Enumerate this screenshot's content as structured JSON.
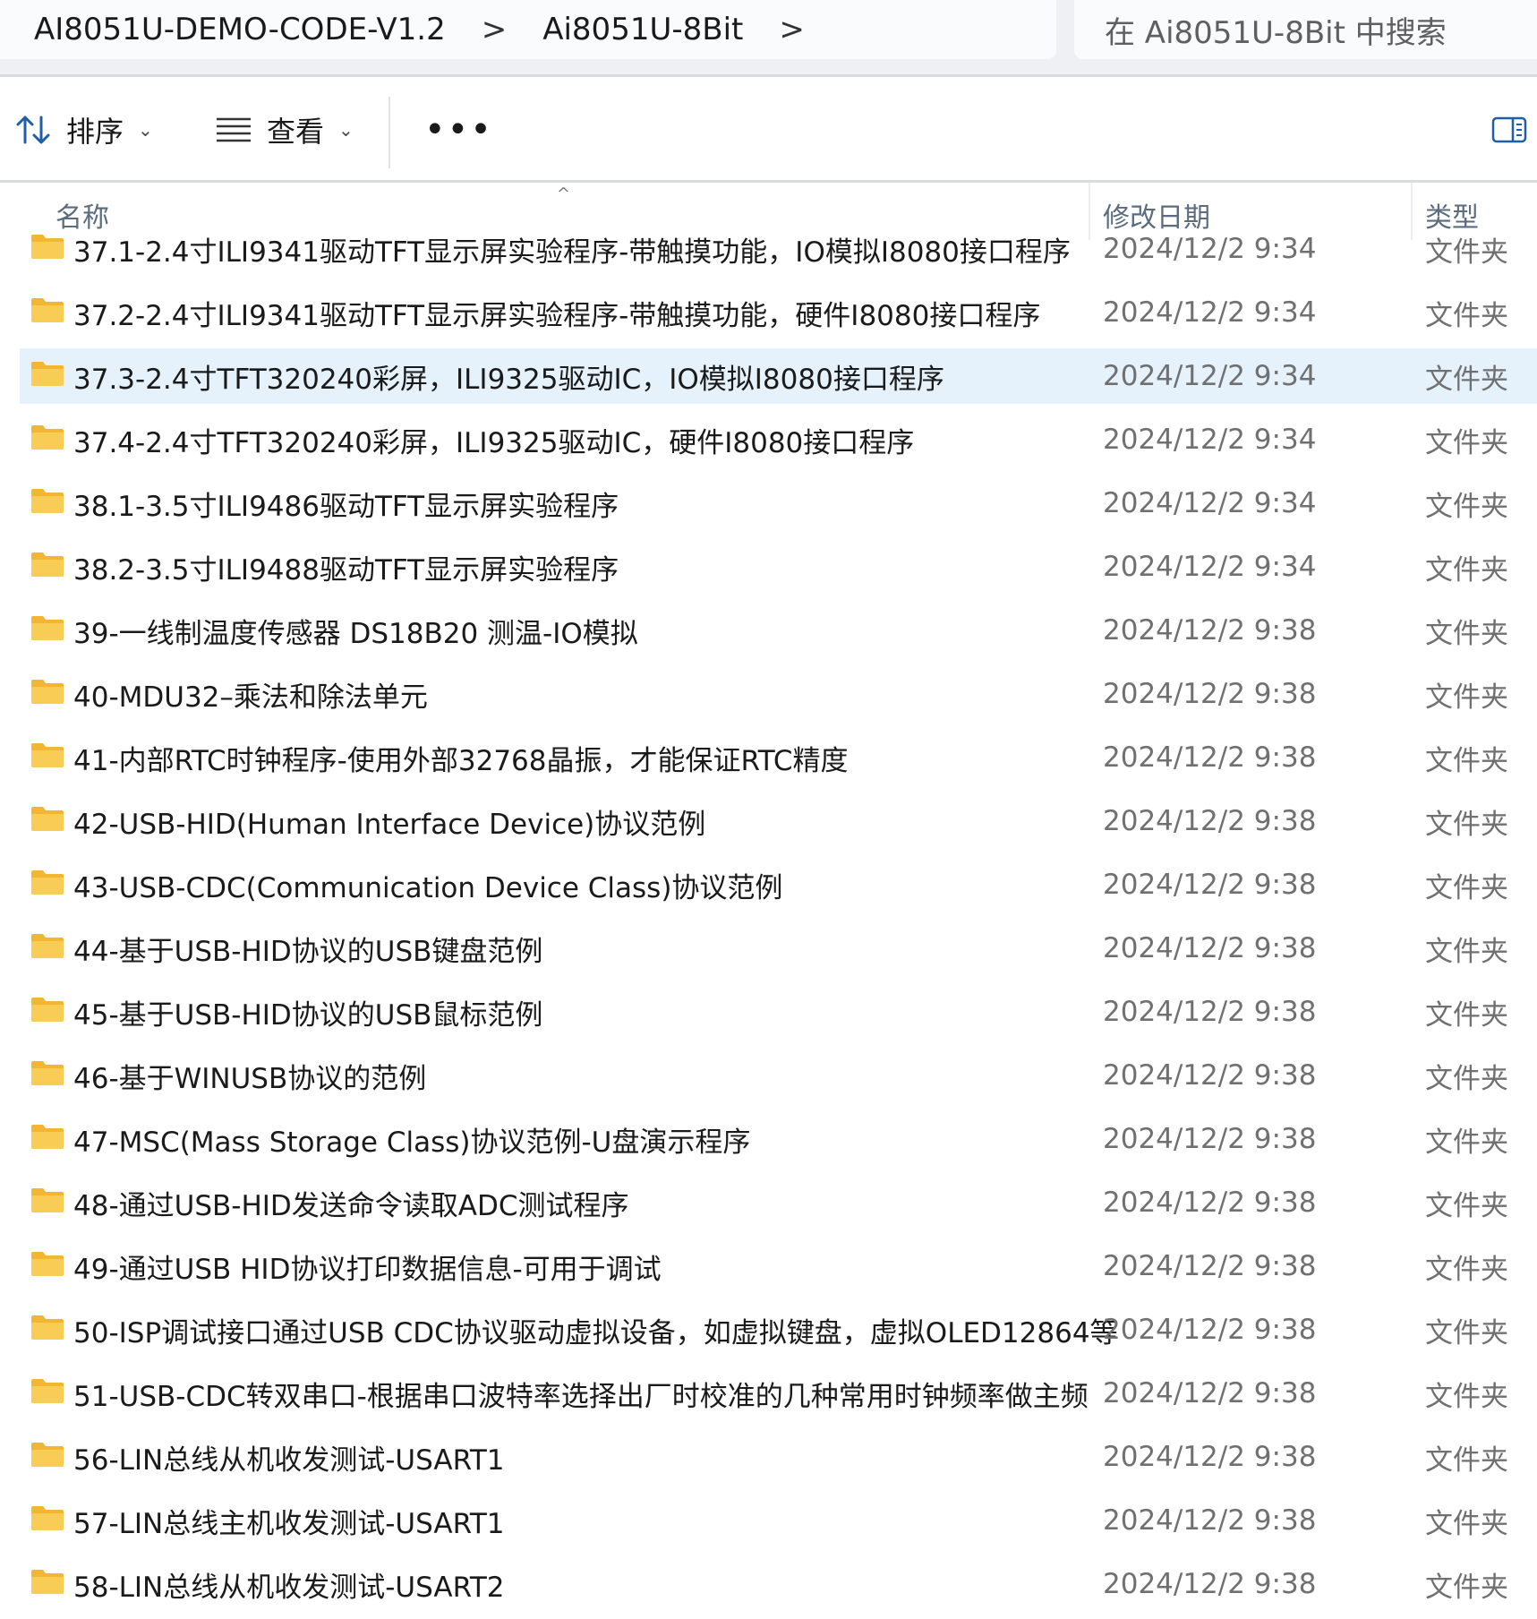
{
  "breadcrumb": {
    "items": [
      "AI8051U-DEMO-CODE-V1.2",
      "Ai8051U-8Bit"
    ],
    "separator": ">"
  },
  "search": {
    "placeholder": "在 Ai8051U-8Bit 中搜索"
  },
  "toolbar": {
    "sort_label": "排序",
    "view_label": "查看",
    "more_label": "•••"
  },
  "columns": {
    "name": "名称",
    "date": "修改日期",
    "type": "类型"
  },
  "colors": {
    "selected_row": "#e5f1fb",
    "folder": "#f5c242",
    "header_text": "#5b6b80"
  },
  "rows": [
    {
      "name": "37.1-2.4寸ILI9341驱动TFT显示屏实验程序-带触摸功能，IO模拟I8080接口程序",
      "date": "2024/12/2 9:34",
      "type": "文件夹",
      "selected": false
    },
    {
      "name": "37.2-2.4寸ILI9341驱动TFT显示屏实验程序-带触摸功能，硬件I8080接口程序",
      "date": "2024/12/2 9:34",
      "type": "文件夹",
      "selected": false
    },
    {
      "name": "37.3-2.4寸TFT320240彩屏，ILI9325驱动IC，IO模拟I8080接口程序",
      "date": "2024/12/2 9:34",
      "type": "文件夹",
      "selected": true
    },
    {
      "name": "37.4-2.4寸TFT320240彩屏，ILI9325驱动IC，硬件I8080接口程序",
      "date": "2024/12/2 9:34",
      "type": "文件夹",
      "selected": false
    },
    {
      "name": "38.1-3.5寸ILI9486驱动TFT显示屏实验程序",
      "date": "2024/12/2 9:34",
      "type": "文件夹",
      "selected": false
    },
    {
      "name": "38.2-3.5寸ILI9488驱动TFT显示屏实验程序",
      "date": "2024/12/2 9:34",
      "type": "文件夹",
      "selected": false
    },
    {
      "name": "39-一线制温度传感器 DS18B20 测温-IO模拟",
      "date": "2024/12/2 9:38",
      "type": "文件夹",
      "selected": false
    },
    {
      "name": "40-MDU32–乘法和除法单元",
      "date": "2024/12/2 9:38",
      "type": "文件夹",
      "selected": false
    },
    {
      "name": "41-内部RTC时钟程序-使用外部32768晶振，才能保证RTC精度",
      "date": "2024/12/2 9:38",
      "type": "文件夹",
      "selected": false
    },
    {
      "name": "42-USB-HID(Human Interface Device)协议范例",
      "date": "2024/12/2 9:38",
      "type": "文件夹",
      "selected": false
    },
    {
      "name": "43-USB-CDC(Communication Device Class)协议范例",
      "date": "2024/12/2 9:38",
      "type": "文件夹",
      "selected": false
    },
    {
      "name": "44-基于USB-HID协议的USB键盘范例",
      "date": "2024/12/2 9:38",
      "type": "文件夹",
      "selected": false
    },
    {
      "name": "45-基于USB-HID协议的USB鼠标范例",
      "date": "2024/12/2 9:38",
      "type": "文件夹",
      "selected": false
    },
    {
      "name": "46-基于WINUSB协议的范例",
      "date": "2024/12/2 9:38",
      "type": "文件夹",
      "selected": false
    },
    {
      "name": "47-MSC(Mass Storage Class)协议范例-U盘演示程序",
      "date": "2024/12/2 9:38",
      "type": "文件夹",
      "selected": false
    },
    {
      "name": "48-通过USB-HID发送命令读取ADC测试程序",
      "date": "2024/12/2 9:38",
      "type": "文件夹",
      "selected": false
    },
    {
      "name": "49-通过USB HID协议打印数据信息-可用于调试",
      "date": "2024/12/2 9:38",
      "type": "文件夹",
      "selected": false
    },
    {
      "name": "50-ISP调试接口通过USB CDC协议驱动虚拟设备，如虚拟键盘，虚拟OLED12864等",
      "date": "2024/12/2 9:38",
      "type": "文件夹",
      "selected": false
    },
    {
      "name": "51-USB-CDC转双串口-根据串口波特率选择出厂时校准的几种常用时钟频率做主频",
      "date": "2024/12/2 9:38",
      "type": "文件夹",
      "selected": false
    },
    {
      "name": "56-LIN总线从机收发测试-USART1",
      "date": "2024/12/2 9:38",
      "type": "文件夹",
      "selected": false
    },
    {
      "name": "57-LIN总线主机收发测试-USART1",
      "date": "2024/12/2 9:38",
      "type": "文件夹",
      "selected": false
    },
    {
      "name": "58-LIN总线从机收发测试-USART2",
      "date": "2024/12/2 9:38",
      "type": "文件夹",
      "selected": false
    }
  ]
}
